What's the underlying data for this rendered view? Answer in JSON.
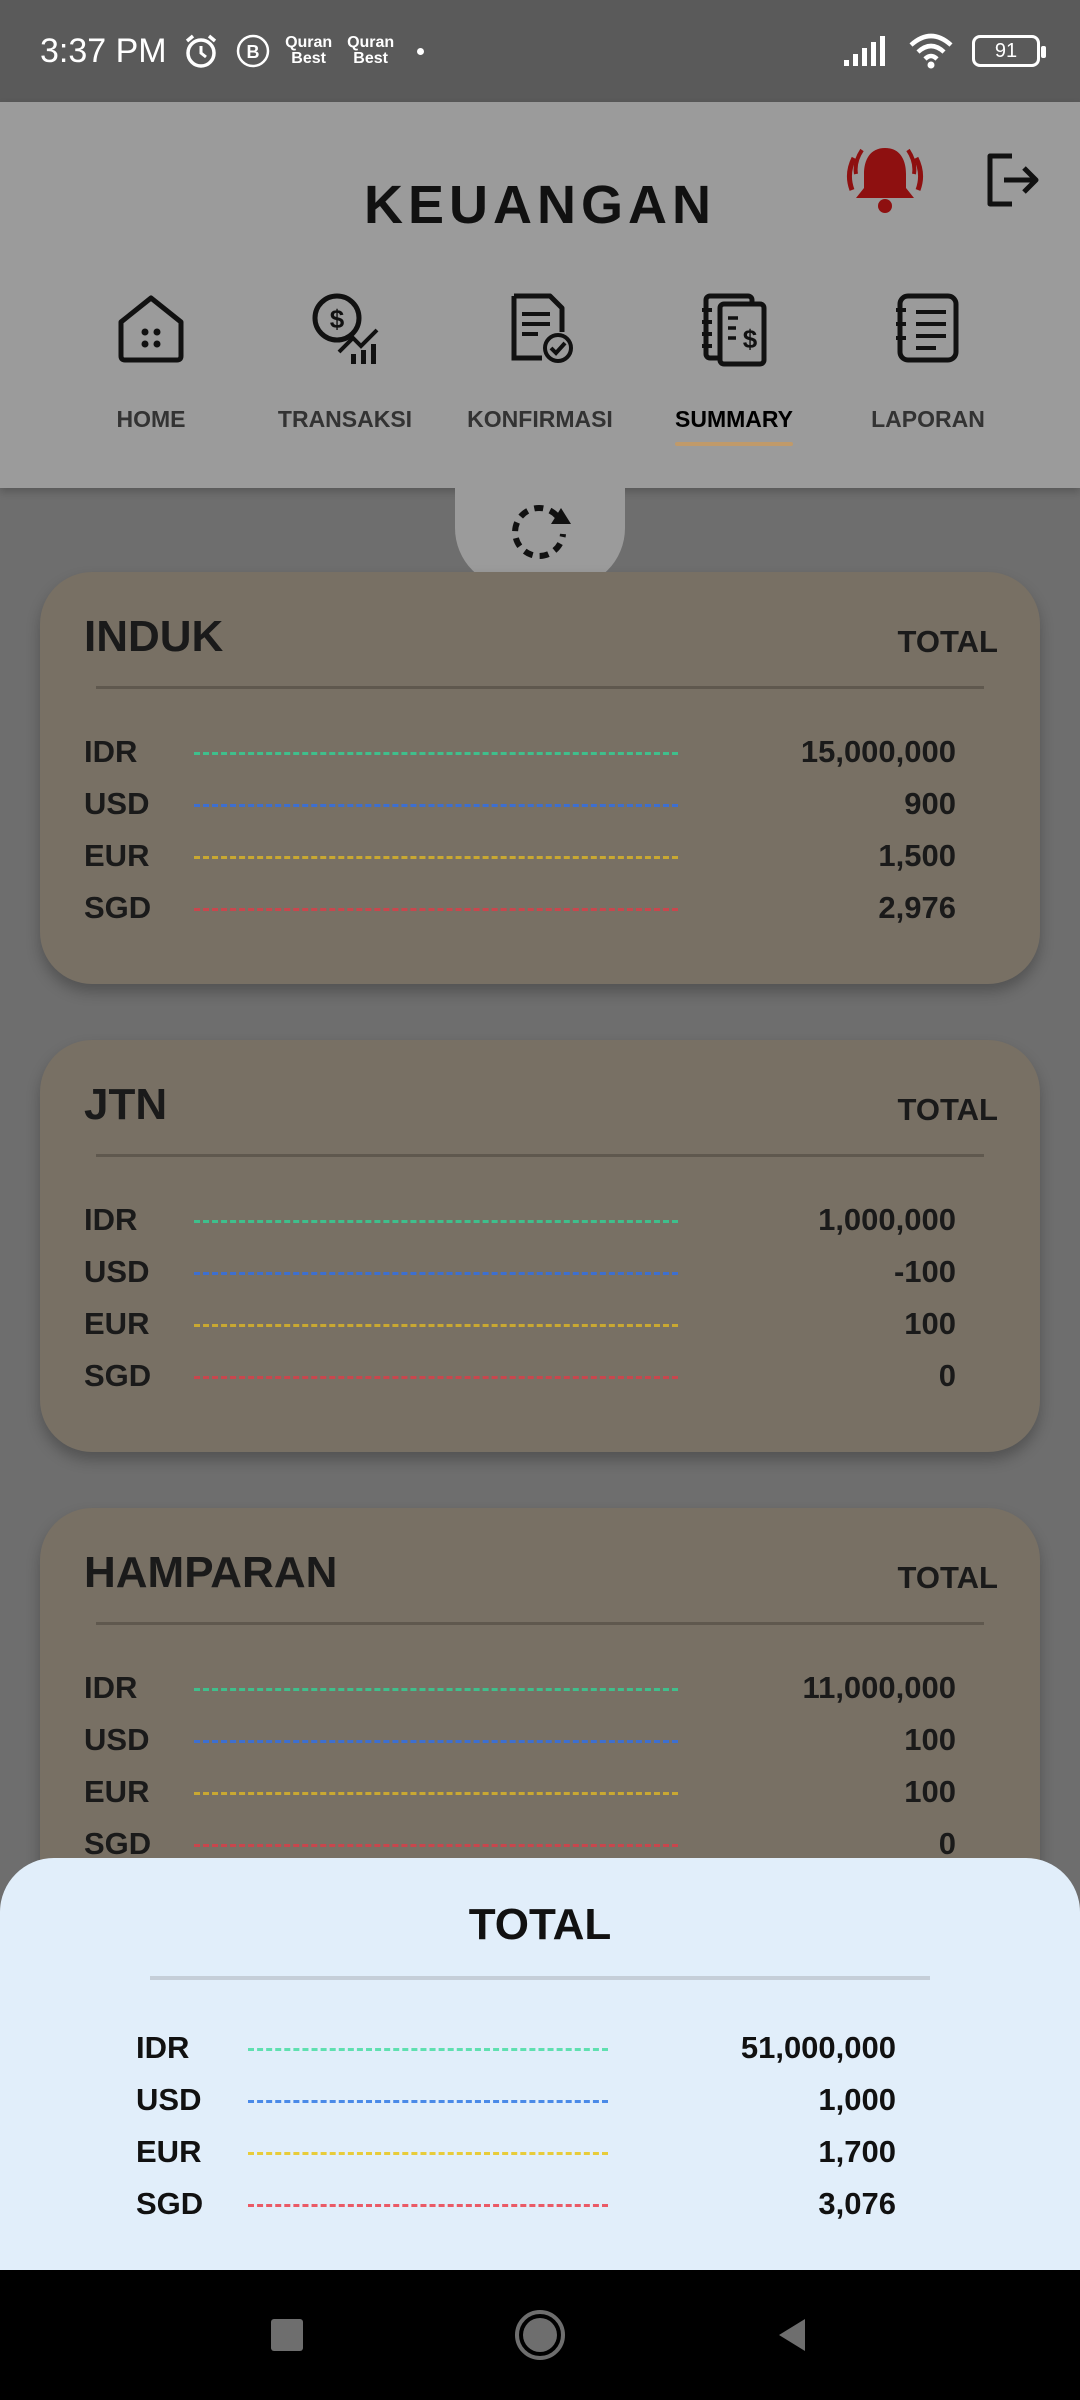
{
  "status": {
    "time": "3:37 PM",
    "app_notif_1": "Quran Best",
    "app_notif_2": "Quran Best",
    "battery": "91"
  },
  "header": {
    "title": "KEUANGAN"
  },
  "nav": [
    {
      "label": "HOME",
      "icon": "home-icon"
    },
    {
      "label": "TRANSAKSI",
      "icon": "money-chart-icon"
    },
    {
      "label": "KONFIRMASI",
      "icon": "document-check-icon"
    },
    {
      "label": "SUMMARY",
      "icon": "notebook-dollar-icon",
      "active": true
    },
    {
      "label": "LAPORAN",
      "icon": "report-list-icon"
    }
  ],
  "currency_colors": {
    "IDR": "#3fbf8c",
    "USD": "#3d6fd1",
    "EUR": "#c9a832",
    "SGD": "#c9464d"
  },
  "cards": [
    {
      "name": "INDUK",
      "total_label": "TOTAL",
      "rows": [
        {
          "currency": "IDR",
          "value": "15,000,000"
        },
        {
          "currency": "USD",
          "value": "900"
        },
        {
          "currency": "EUR",
          "value": "1,500"
        },
        {
          "currency": "SGD",
          "value": "2,976"
        }
      ]
    },
    {
      "name": "JTN",
      "total_label": "TOTAL",
      "rows": [
        {
          "currency": "IDR",
          "value": "1,000,000"
        },
        {
          "currency": "USD",
          "value": "-100"
        },
        {
          "currency": "EUR",
          "value": "100"
        },
        {
          "currency": "SGD",
          "value": "0"
        }
      ]
    },
    {
      "name": "HAMPARAN",
      "total_label": "TOTAL",
      "rows": [
        {
          "currency": "IDR",
          "value": "11,000,000"
        },
        {
          "currency": "USD",
          "value": "100"
        },
        {
          "currency": "EUR",
          "value": "100"
        },
        {
          "currency": "SGD",
          "value": "0"
        }
      ]
    }
  ],
  "total": {
    "title": "TOTAL",
    "rows": [
      {
        "currency": "IDR",
        "value": "51,000,000"
      },
      {
        "currency": "USD",
        "value": "1,000"
      },
      {
        "currency": "EUR",
        "value": "1,700"
      },
      {
        "currency": "SGD",
        "value": "3,076"
      }
    ]
  }
}
